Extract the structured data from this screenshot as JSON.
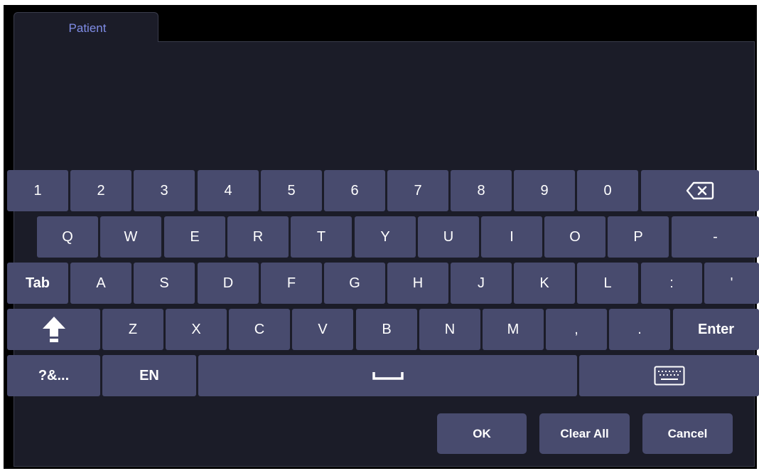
{
  "tab": {
    "label": "Patient"
  },
  "keyboard": {
    "row1": [
      "1",
      "2",
      "3",
      "4",
      "5",
      "6",
      "7",
      "8",
      "9",
      "0"
    ],
    "row2": [
      "Q",
      "W",
      "E",
      "R",
      "T",
      "Y",
      "U",
      "I",
      "O",
      "P",
      "-"
    ],
    "row3": [
      "Tab",
      "A",
      "S",
      "D",
      "F",
      "G",
      "H",
      "J",
      "K",
      "L",
      ":",
      "'"
    ],
    "row4": [
      "Z",
      "X",
      "C",
      "V",
      "B",
      "N",
      "M",
      ",",
      "."
    ],
    "enter": "Enter",
    "symbols": "?&...",
    "language": "EN",
    "icons": {
      "backspace": "backspace-icon",
      "shift": "shift-arrow-icon",
      "space": "space-bar-icon",
      "hide": "keyboard-icon"
    }
  },
  "actions": {
    "ok": "OK",
    "clear_all": "Clear All",
    "cancel": "Cancel"
  },
  "colors": {
    "background": "#000000",
    "panel": "#1b1c28",
    "key": "#484b6e",
    "tab_text": "#7f8ce6",
    "key_text": "#ffffff"
  }
}
